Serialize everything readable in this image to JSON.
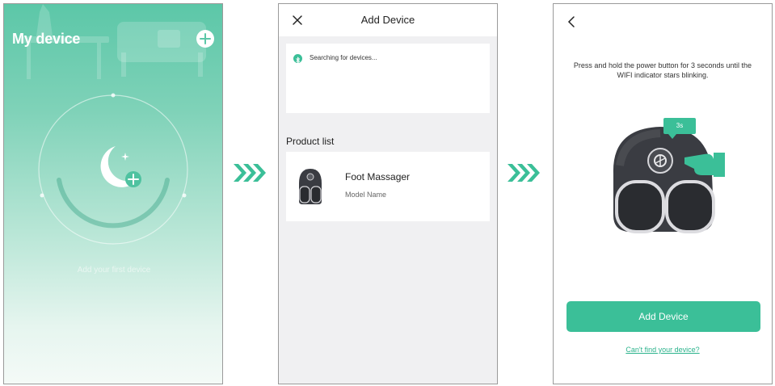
{
  "screen1": {
    "title": "My device",
    "add_icon": "plus-icon",
    "empty_state_icon": "moon-add-icon",
    "empty_text": "Add your first device"
  },
  "arrows": [
    "chevron-triple-right-icon",
    "chevron-triple-right-icon"
  ],
  "screen2": {
    "header_title": "Add Device",
    "close_icon": "close-icon",
    "searching_text": "Searching for devices...",
    "section_title": "Product list",
    "products": [
      {
        "name": "Foot Massager",
        "model": "Model Name"
      }
    ]
  },
  "screen3": {
    "back_icon": "chevron-left-icon",
    "instruction": "Press and hold the power button for 3 seconds until the WIFI indicator stars blinking.",
    "badge_text": "3s",
    "primary_button": "Add Device",
    "help_link": "Can't find your device?"
  },
  "colors": {
    "accent": "#3bbf98",
    "gradient_top": "#5cc7a8",
    "device_dark": "#3a3c42"
  }
}
